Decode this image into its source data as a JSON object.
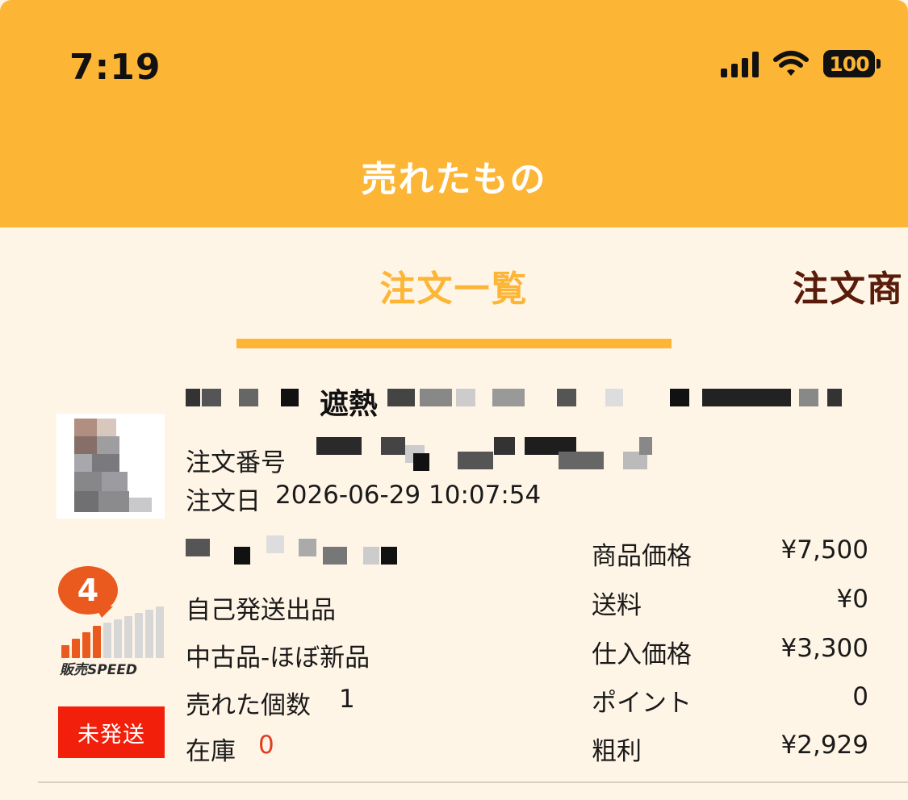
{
  "status_bar": {
    "time": "7:19",
    "battery": "100"
  },
  "header": {
    "title": "売れたもの"
  },
  "tabs": [
    {
      "label": "注文一覧",
      "active": true
    },
    {
      "label": "注文商"
    }
  ],
  "order": {
    "title_visible": "遮熱",
    "order_number_label": "注文番号",
    "order_date_label": "注文日",
    "order_date": "2026-06-29 10:07:54",
    "shipping_method": "自己発送出品",
    "condition": "中古品-ほぼ新品",
    "sold_count_label": "売れた個数",
    "sold_count": "1",
    "stock_label": "在庫",
    "stock": "0",
    "status_badge": "未発送",
    "speed_rank": "4",
    "speed_label": "販売SPEED"
  },
  "pricing": [
    {
      "label": "商品価格",
      "value": "¥7,500"
    },
    {
      "label": "送料",
      "value": "¥0"
    },
    {
      "label": "仕入価格",
      "value": "¥3,300"
    },
    {
      "label": "ポイント",
      "value": "0"
    },
    {
      "label": "粗利",
      "value": "¥2,929"
    }
  ],
  "colors": {
    "header_bg": "#fdb535",
    "content_bg": "#fff5e7",
    "active_tab": "#fdb535",
    "inactive_tab": "#5a1c0a",
    "badge_red": "#f21f0b",
    "speed_orange": "#ea5a1f",
    "stock_red": "#e43d1f"
  },
  "icons": {
    "signal": "cellular-signal-icon",
    "wifi": "wifi-icon",
    "battery": "battery-icon"
  }
}
